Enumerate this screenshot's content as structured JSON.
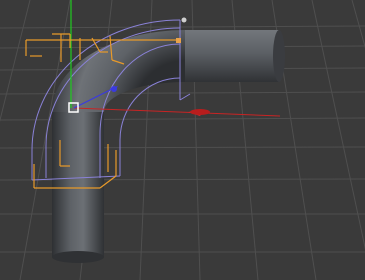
{
  "viewport": {
    "view": "perspective",
    "background_color": "#3a3a3a",
    "grid_color": "#4d4d4d",
    "grid_visible": true
  },
  "scene": {
    "object": "bent-tube",
    "object_color": "#5a5e63",
    "bounding_box_color": "#8a82d8",
    "selection_bracket_color": "#e89a2a",
    "deformer_handle_color": "#e8a24a"
  },
  "axes": {
    "x_color": "#d42a2a",
    "y_color": "#1fcc1f",
    "z_color": "#3a3ae0"
  },
  "gizmo": {
    "anchor_handle_color": "#ffffff"
  }
}
